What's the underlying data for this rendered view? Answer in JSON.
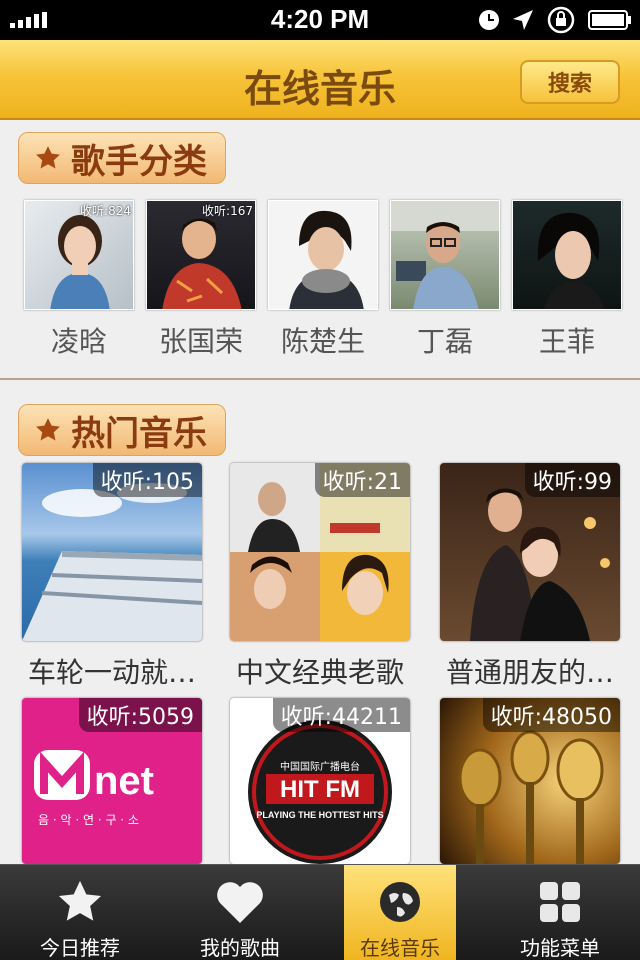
{
  "status_bar": {
    "time": "4:20 PM"
  },
  "nav": {
    "title": "在线音乐",
    "search_label": "搜索"
  },
  "sections": {
    "singers_title": "歌手分类",
    "hot_title": "热门音乐"
  },
  "singers": [
    {
      "name": "凌晗",
      "listens": "收听:824"
    },
    {
      "name": "张国荣",
      "listens": "收听:167"
    },
    {
      "name": "陈楚生",
      "listens": ""
    },
    {
      "name": "丁磊",
      "listens": ""
    },
    {
      "name": "王菲",
      "listens": ""
    }
  ],
  "hot_music": [
    {
      "title": "车轮一动就…",
      "count": "收听:105"
    },
    {
      "title": "中文经典老歌",
      "count": "收听:21"
    },
    {
      "title": "普通朋友的…",
      "count": "收听:99"
    },
    {
      "title": "",
      "count": "收听:5059",
      "logo_main": "net",
      "logo_sub": "음 · 악 · 연 · 구 · 소"
    },
    {
      "title": "",
      "count": "收听:44211",
      "logo_top": "中国国际广播电台",
      "logo_main": "HIT FM",
      "logo_sub": "PLAYING THE HOTTEST HITS"
    },
    {
      "title": "",
      "count": "收听:48050"
    }
  ],
  "tabs": [
    {
      "label": "今日推荐",
      "icon": "star-icon"
    },
    {
      "label": "我的歌曲",
      "icon": "heart-icon"
    },
    {
      "label": "在线音乐",
      "icon": "globe-icon",
      "active": true
    },
    {
      "label": "功能菜单",
      "icon": "grid-icon"
    }
  ],
  "colors": {
    "accent": "#f7c43a",
    "title_brown": "#7a4a0e",
    "section_text": "#8a3c10"
  }
}
